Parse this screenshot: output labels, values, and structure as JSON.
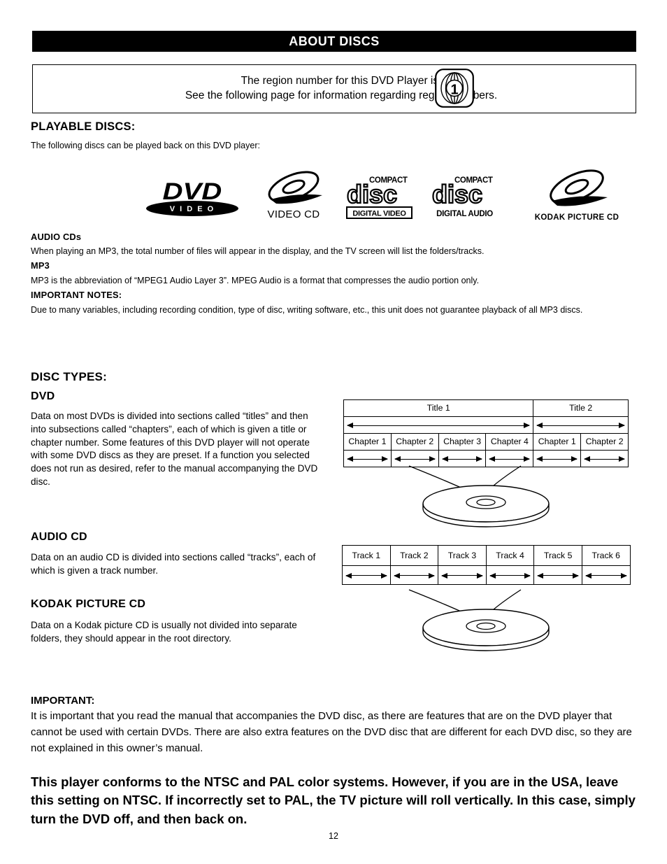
{
  "header": {
    "title": "ABOUT DISCS"
  },
  "region_box": {
    "line1": "The region number for this DVD Player is:",
    "line2": "See the following page for information regarding region numbers.",
    "region_number": "1"
  },
  "playable": {
    "heading": "PLAYABLE DISCS:",
    "intro": "The following discs can be played back on this DVD player:",
    "logos": [
      {
        "name": "dvd-video-logo",
        "main": "DVD",
        "sub": "V I D E O"
      },
      {
        "name": "video-cd-logo",
        "caption": "VIDEO CD"
      },
      {
        "name": "compact-disc-digital-video-logo",
        "top": "COMPACT",
        "mid": "disc",
        "caption": "DIGITAL VIDEO"
      },
      {
        "name": "compact-disc-digital-audio-logo",
        "top": "COMPACT",
        "mid": "disc",
        "caption": "DIGITAL AUDIO"
      },
      {
        "name": "kodak-picture-cd-logo",
        "caption": "KODAK PICTURE CD"
      }
    ],
    "notes": [
      {
        "heading": "AUDIO CDs",
        "text": "When playing an MP3, the total number of files will appear in the display, and the TV screen will list the folders/tracks."
      },
      {
        "heading": "MP3",
        "text": "MP3 is the abbreviation of “MPEG1 Audio Layer 3”. MPEG Audio is a format that compresses the audio portion only."
      },
      {
        "heading": "IMPORTANT NOTES:",
        "text": "Due to many variables, including recording condition, type of disc, writing software, etc., this unit does not guarantee playback of all MP3 discs."
      }
    ]
  },
  "disc_types": {
    "heading": "DISC TYPES:",
    "dvd": {
      "heading": "DVD",
      "text": "Data on most DVDs is divided into sections called “titles” and then into subsections called “chapters”, each of which is given a title or chapter number. Some features of this DVD player will not operate with some DVD discs as they are preset. If a function you selected does not run as desired, refer to the manual accompanying the DVD disc.",
      "diagram": {
        "titles": [
          {
            "label": "Title 1",
            "span": 4
          },
          {
            "label": "Title 2",
            "span": 2
          }
        ],
        "chapters": [
          "Chapter 1",
          "Chapter 2",
          "Chapter 3",
          "Chapter 4",
          "Chapter 1",
          "Chapter 2"
        ]
      }
    },
    "audio_cd": {
      "heading": "AUDIO CD",
      "text": "Data on an audio CD is divided into sections called “tracks”, each of which is given a track number.",
      "diagram": {
        "tracks": [
          "Track 1",
          "Track 2",
          "Track 3",
          "Track 4",
          "Track 5",
          "Track 6"
        ]
      }
    },
    "kodak": {
      "heading": "KODAK PICTURE CD",
      "text": "Data on a Kodak picture CD is usually not divided into separate folders, they should appear in the root directory."
    }
  },
  "important": {
    "heading": "IMPORTANT:",
    "text": "It is important that you read the manual that accompanies the DVD disc, as there are features that are on the DVD player that cannot be used with certain DVDs. There are also extra features on the DVD disc that are different for each DVD disc, so they are not explained in this owner’s manual."
  },
  "ntsc_notice": "This player conforms to the NTSC and PAL color systems. However, if you are in the USA, leave this setting on NTSC. If incorrectly set to PAL, the TV picture will roll vertically. In this case, simply turn the DVD off, and then back on.",
  "page_number": "12",
  "colors": {
    "ink": "#000000",
    "paper": "#ffffff"
  }
}
